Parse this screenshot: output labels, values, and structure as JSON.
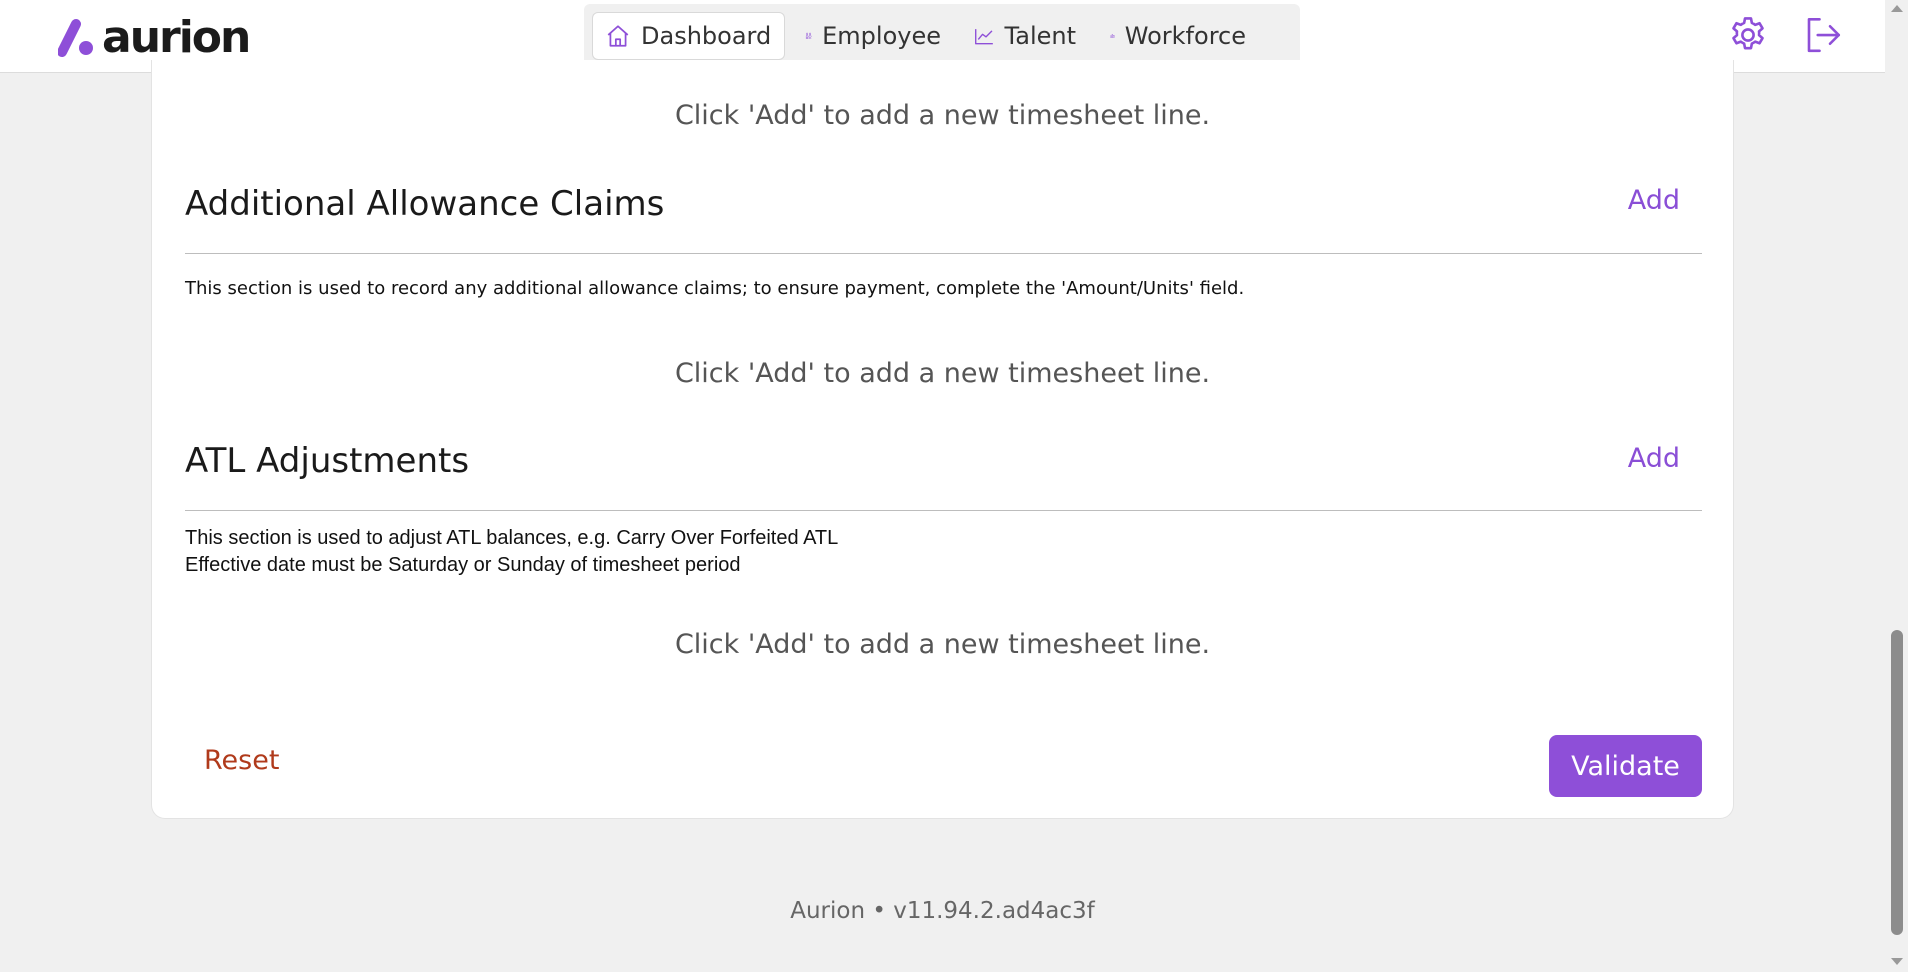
{
  "header": {
    "logo_text": "aurion",
    "nav": [
      {
        "label": "Dashboard",
        "icon": "home-icon",
        "active": true
      },
      {
        "label": "Employee",
        "icon": "people-icon"
      },
      {
        "label": "Talent",
        "icon": "trend-chart-icon"
      },
      {
        "label": "Workforce",
        "icon": "bar-chart-icon"
      }
    ],
    "settings_icon": "gear-icon",
    "logout_icon": "logout-icon"
  },
  "main": {
    "top_empty_message": "Click 'Add' to add a new timesheet line.",
    "sections": [
      {
        "title": "Additional Allowance Claims",
        "add_label": "Add",
        "description": "This section is used to record any additional allowance claims; to ensure payment, complete the 'Amount/Units' field.",
        "empty_message": "Click 'Add' to add a new timesheet line."
      },
      {
        "title": "ATL Adjustments",
        "add_label": "Add",
        "description_lines": [
          "This section is used to adjust ATL balances, e.g. Carry Over Forfeited ATL",
          "Effective date must be Saturday or Sunday of timesheet period"
        ],
        "empty_message": "Click 'Add' to add a new timesheet line."
      }
    ],
    "reset_label": "Reset",
    "validate_label": "Validate"
  },
  "footer": {
    "text": "Aurion • v11.94.2.ad4ac3f"
  },
  "colors": {
    "accent": "#8e4fd8",
    "link": "#8a4ed6",
    "reset": "#b03a1b",
    "background": "#f0f0f0"
  }
}
